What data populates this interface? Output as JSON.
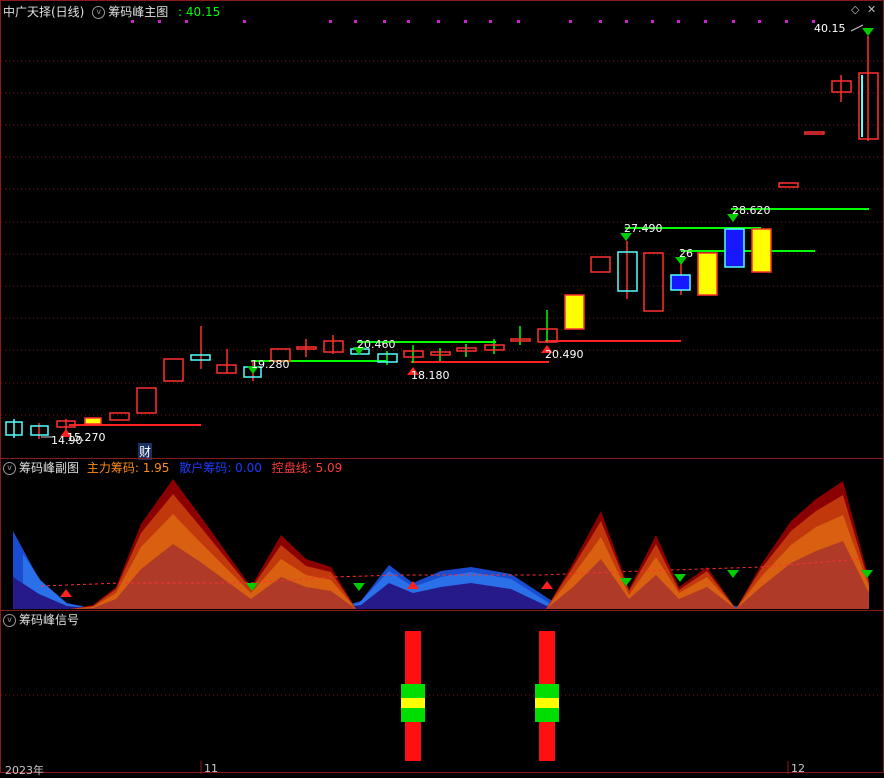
{
  "main": {
    "symbol": "中广天择(日线)",
    "indicator": "筹码峰主图",
    "value_sep": ":",
    "value": "40.15",
    "price_labels": [
      {
        "text": "40.15"
      },
      {
        "text": "28.620"
      },
      {
        "text": "27.490"
      },
      {
        "text": "26"
      },
      {
        "text": "20.490"
      },
      {
        "text": "20.460"
      },
      {
        "text": "19.280"
      },
      {
        "text": "18.180"
      },
      {
        "text": "15.270"
      },
      {
        "text": "14.90"
      }
    ],
    "cai_badge": "财"
  },
  "sub": {
    "title": "筹码峰副图",
    "main_chips_label": "主力筹码:",
    "main_chips_value": "1.95",
    "retail_chips_label": "散户筹码:",
    "retail_chips_value": "0.00",
    "control_line_label": "控盘线:",
    "control_line_value": "5.09"
  },
  "signal": {
    "title": "筹码峰信号"
  },
  "axis": {
    "year_label": "2023年",
    "nov_label": "11",
    "dec_label": "12"
  },
  "colors": {
    "up": "#ff3030",
    "down": "#54ffff",
    "yellow": "#ffff00",
    "blue": "#1818ff",
    "green_line": "#00ff00",
    "red_line": "#ff2020"
  }
}
